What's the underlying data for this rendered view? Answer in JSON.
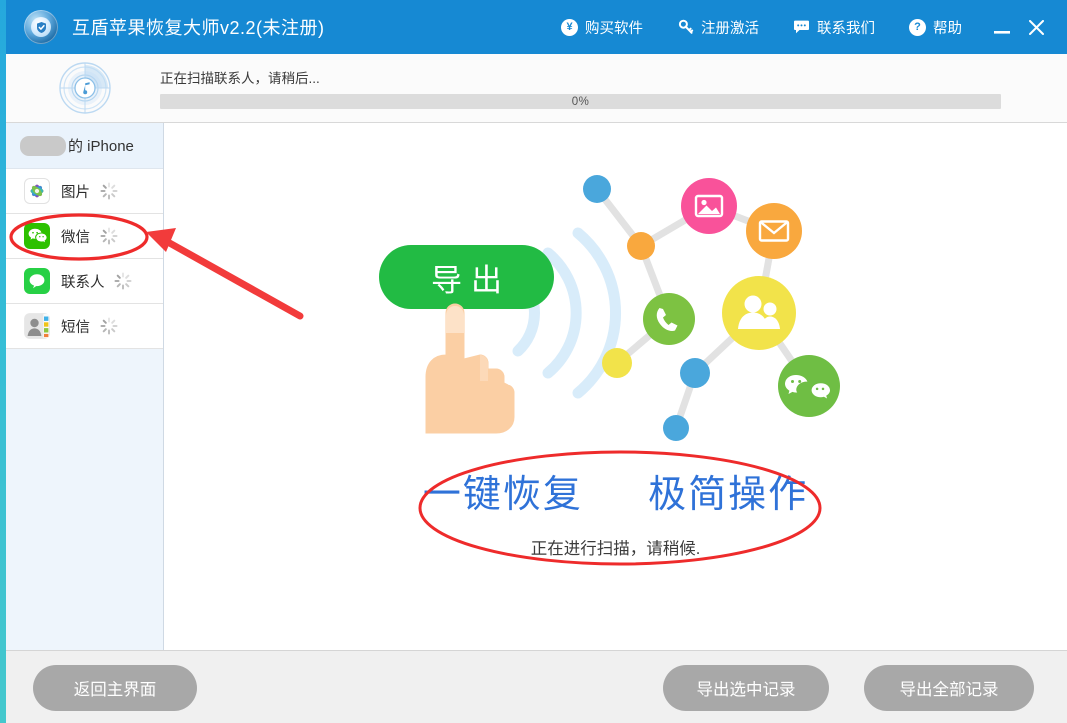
{
  "window": {
    "title": "互盾苹果恢复大师v2.2(未注册)",
    "logo_icon": "shield-check-icon",
    "menu": [
      {
        "label": "购买软件",
        "icon": "yen-coin-icon",
        "glyph": "¥"
      },
      {
        "label": "注册激活",
        "icon": "key-icon",
        "glyph": "key"
      },
      {
        "label": "联系我们",
        "icon": "chat-bubble-icon",
        "glyph": "chat"
      },
      {
        "label": "帮助",
        "icon": "question-mark-icon",
        "glyph": "?"
      }
    ],
    "minimize_label": "—",
    "close_label": "✕"
  },
  "scan": {
    "radar_icon": "radar-music-scan-icon",
    "status_text": "正在扫描联系人，请稍后...",
    "progress_percent": 0,
    "progress_label": "0%"
  },
  "sidebar": {
    "device": {
      "name": "的 iPhone",
      "redacted": true
    },
    "items": [
      {
        "label": "图片",
        "icon": "photos-app-icon",
        "loading": true
      },
      {
        "label": "微信",
        "icon": "wechat-icon",
        "loading": true,
        "highlighted": true
      },
      {
        "label": "联系人",
        "icon": "messages-bubble-icon",
        "loading": true
      },
      {
        "label": "短信",
        "icon": "contact-card-icon",
        "loading": true
      }
    ]
  },
  "main": {
    "export_button_label": "导出",
    "hand_icon": "pointing-hand-icon",
    "wifi_icon": "wifi-waves-icon",
    "network_icon": "connected-nodes-illustration",
    "headline_left": "一键恢复",
    "headline_right": "极简操作",
    "sub_text": "正在进行扫描，请稍候.",
    "nodes": [
      {
        "name": "photo-node",
        "icon": "image-icon",
        "color": "#f9529a"
      },
      {
        "name": "mail-node",
        "icon": "envelope-icon",
        "color": "#f9a83e"
      },
      {
        "name": "contacts-node",
        "icon": "people-icon",
        "color": "#f2e34a"
      },
      {
        "name": "phone-node",
        "icon": "phone-handset-icon",
        "color": "#7dc242"
      },
      {
        "name": "wechat-node",
        "icon": "wechat-icon",
        "color": "#6fbe44"
      }
    ]
  },
  "annotations": {
    "circle_sidebar": "red-ellipse-around-wechat",
    "arrow": "red-arrow-pointing-to-wechat",
    "circle_caption": "red-ellipse-around-headline",
    "color": "#ee2b2b"
  },
  "footer": {
    "back_label": "返回主界面",
    "export_selected_label": "导出选中记录",
    "export_all_label": "导出全部记录"
  },
  "colors": {
    "titlebar": "#1689d3",
    "accent_green": "#22bb44",
    "headline_blue": "#2f72d8",
    "annotation_red": "#ee2b2b"
  }
}
